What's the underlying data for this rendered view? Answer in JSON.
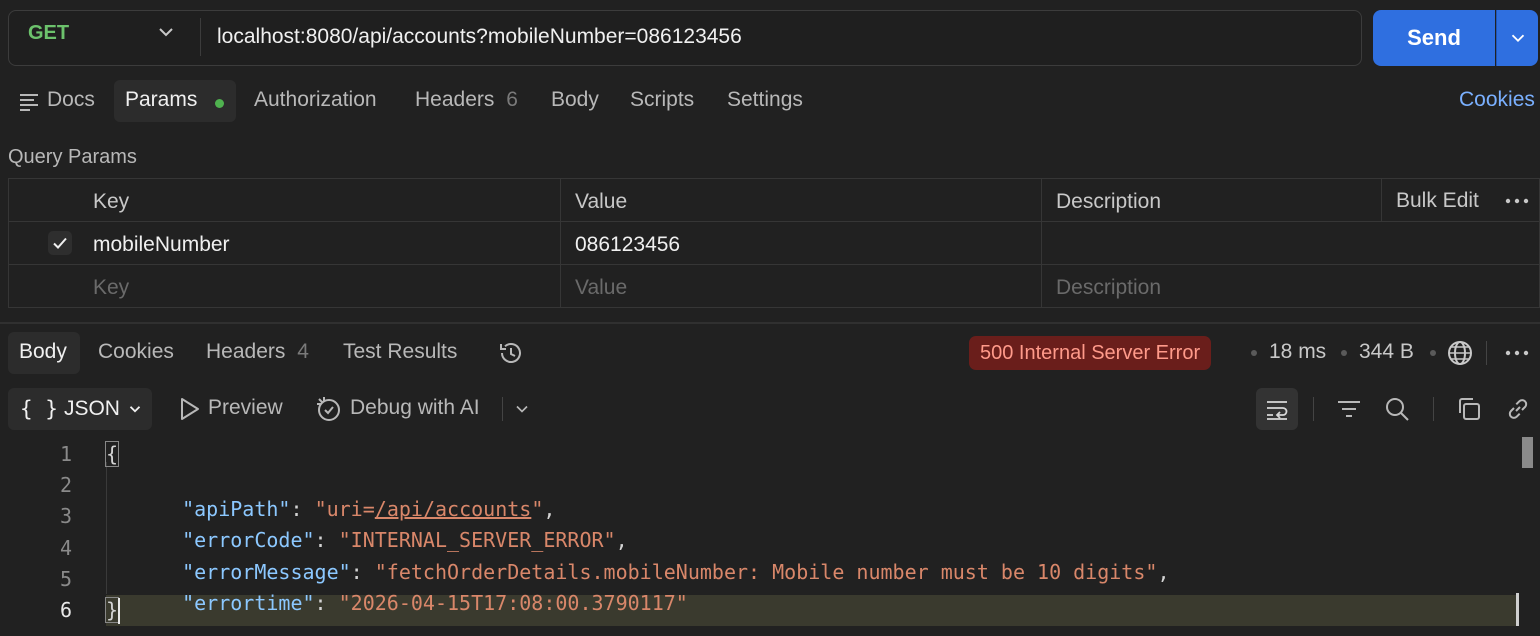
{
  "request": {
    "method": "GET",
    "url": "localhost:8080/api/accounts?mobileNumber=086123456",
    "send_label": "Send"
  },
  "request_tabs": {
    "docs": "Docs",
    "params": "Params",
    "authorization": "Authorization",
    "headers": "Headers",
    "headers_count": "6",
    "body": "Body",
    "scripts": "Scripts",
    "settings": "Settings",
    "cookies": "Cookies"
  },
  "query_params": {
    "title": "Query Params",
    "columns": {
      "key": "Key",
      "value": "Value",
      "description": "Description"
    },
    "bulk_edit": "Bulk Edit",
    "rows": [
      {
        "key": "mobileNumber",
        "value": "086123456",
        "description": ""
      }
    ],
    "placeholders": {
      "key": "Key",
      "value": "Value",
      "description": "Description"
    }
  },
  "response_tabs": {
    "body": "Body",
    "cookies": "Cookies",
    "headers": "Headers",
    "headers_count": "4",
    "test_results": "Test Results"
  },
  "response_meta": {
    "status": "500 Internal Server Error",
    "time": "18 ms",
    "size": "344 B"
  },
  "response_toolbar": {
    "format": "JSON",
    "preview": "Preview",
    "debug": "Debug with AI"
  },
  "colors": {
    "accent": "#2f6fe0",
    "method_get": "#6cc26c",
    "status_error_bg": "#6a1e1b",
    "status_error_text": "#ff9a8a",
    "json_key": "#8cc8ff",
    "json_string": "#d9876a"
  },
  "code_lines": {
    "l1": "{",
    "l2_key": "\"apiPath\"",
    "l2_val_prefix": "\"uri=",
    "l2_val_link": "/api/accounts",
    "l2_val_suffix": "\"",
    "l3_key": "\"errorCode\"",
    "l3_val": "\"INTERNAL_SERVER_ERROR\"",
    "l4_key": "\"errorMessage\"",
    "l4_val": "\"fetchOrderDetails.mobileNumber: Mobile number must be 10 digits\"",
    "l5_key": "\"errortime\"",
    "l5_val": "\"2026-04-15T17:08:00.3790117\"",
    "l6": "}"
  },
  "line_numbers": [
    "1",
    "2",
    "3",
    "4",
    "5",
    "6"
  ]
}
